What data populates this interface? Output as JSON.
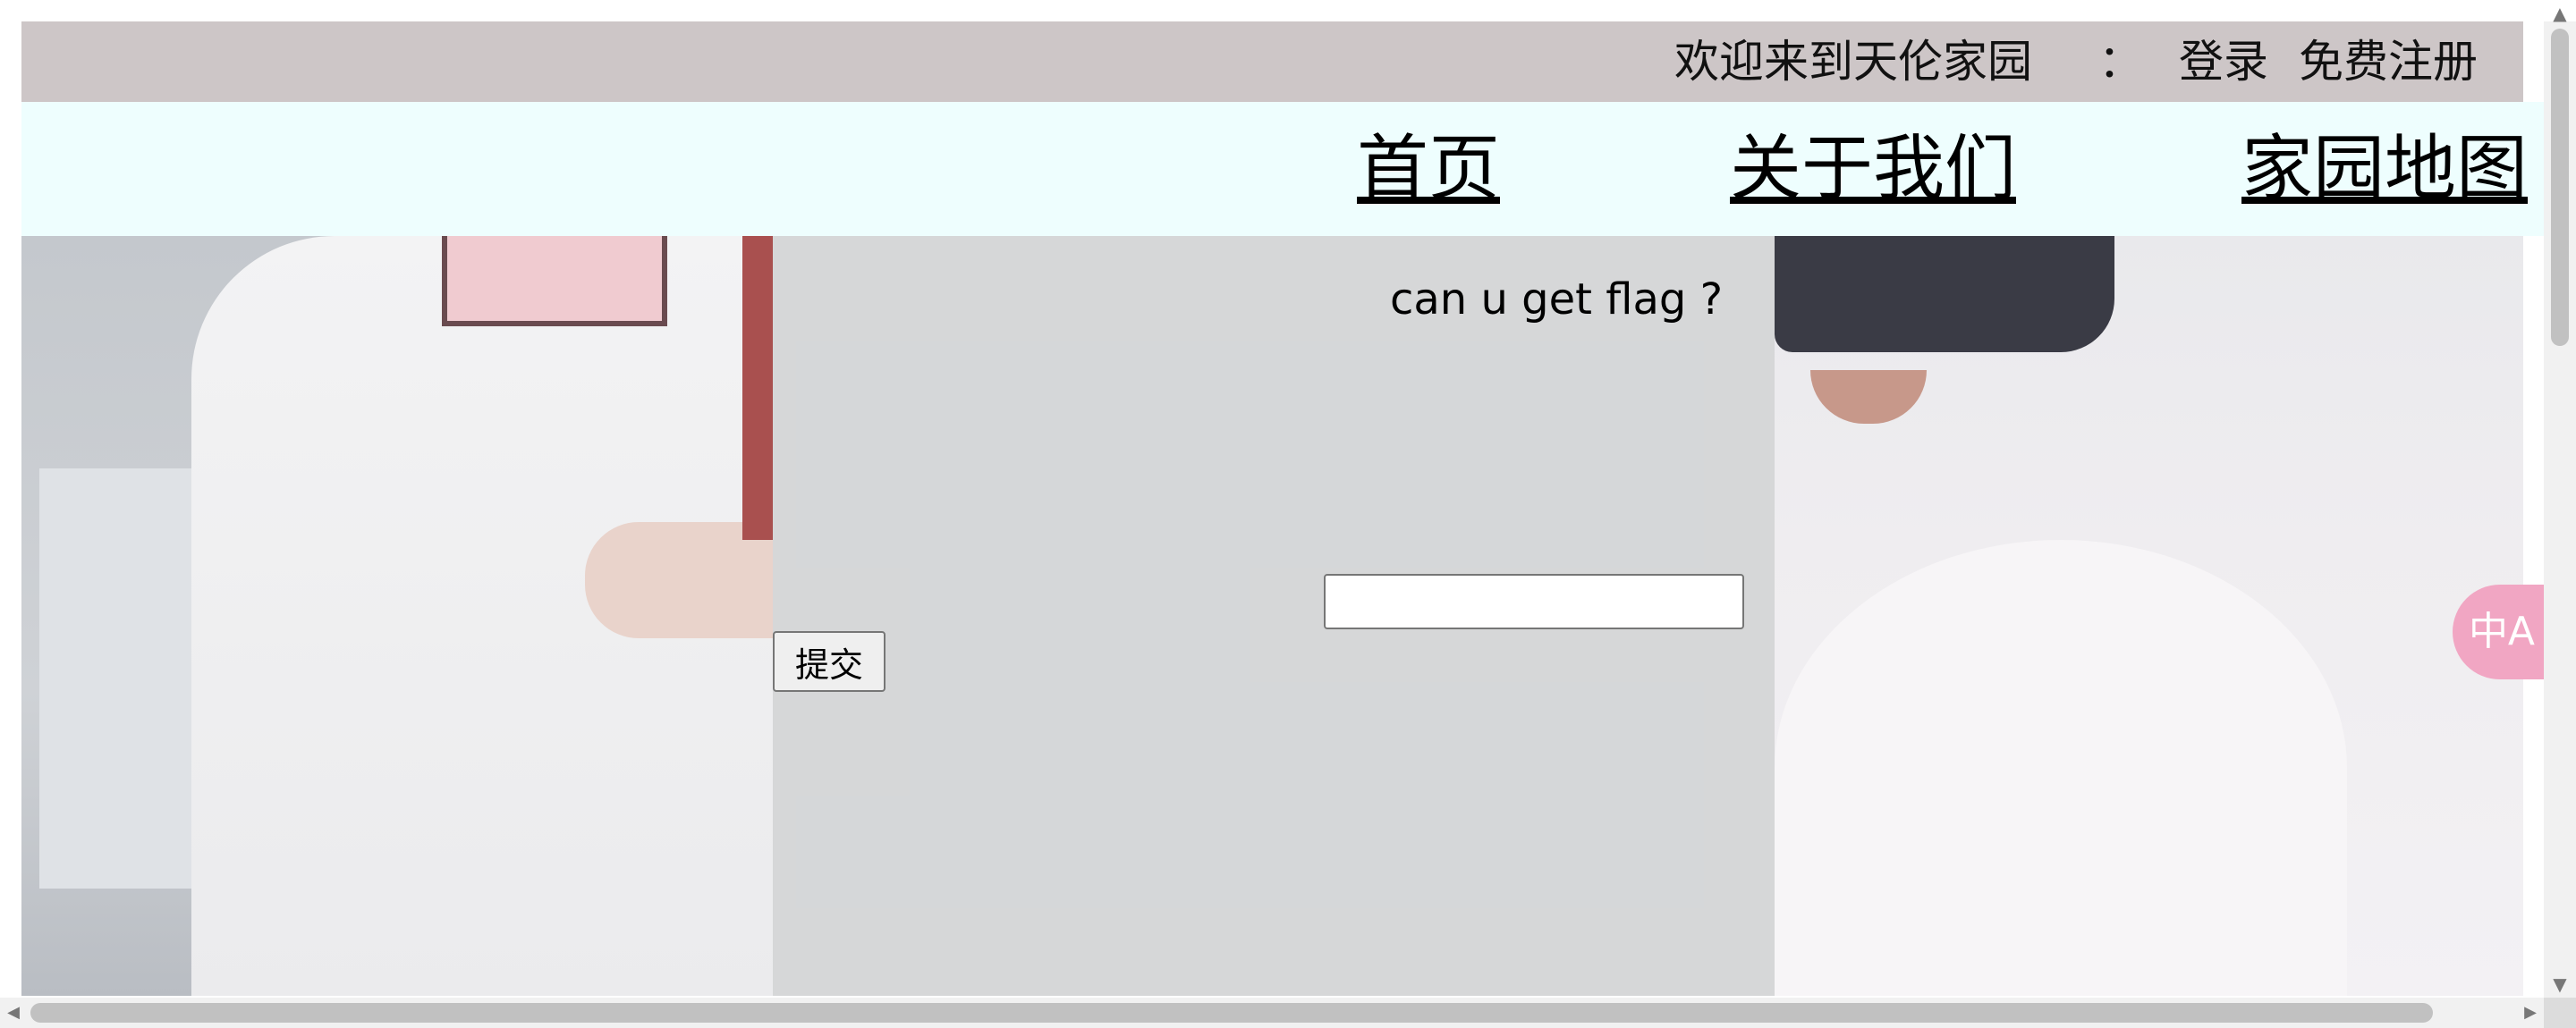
{
  "topbar": {
    "welcome": "欢迎来到天伦家园",
    "colon": "：",
    "login": "登录",
    "register": "免费注册"
  },
  "nav": {
    "home": "首页",
    "about": "关于我们",
    "map": "家园地图"
  },
  "form": {
    "question": "can u get flag ?",
    "input_value": "",
    "submit_label": "提交"
  },
  "translate": {
    "icon_text": "中A"
  },
  "colors": {
    "topbar_bg": "#cdc6c7",
    "nav_bg": "#eefefe",
    "overlay_bg": "#d6d7d9",
    "translate_bg": "#f1a6c3"
  },
  "icons": {
    "translate": "translate-icon",
    "scroll_up": "arrow-up-icon",
    "scroll_down": "arrow-down-icon",
    "scroll_left": "arrow-left-icon",
    "scroll_right": "arrow-right-icon"
  }
}
